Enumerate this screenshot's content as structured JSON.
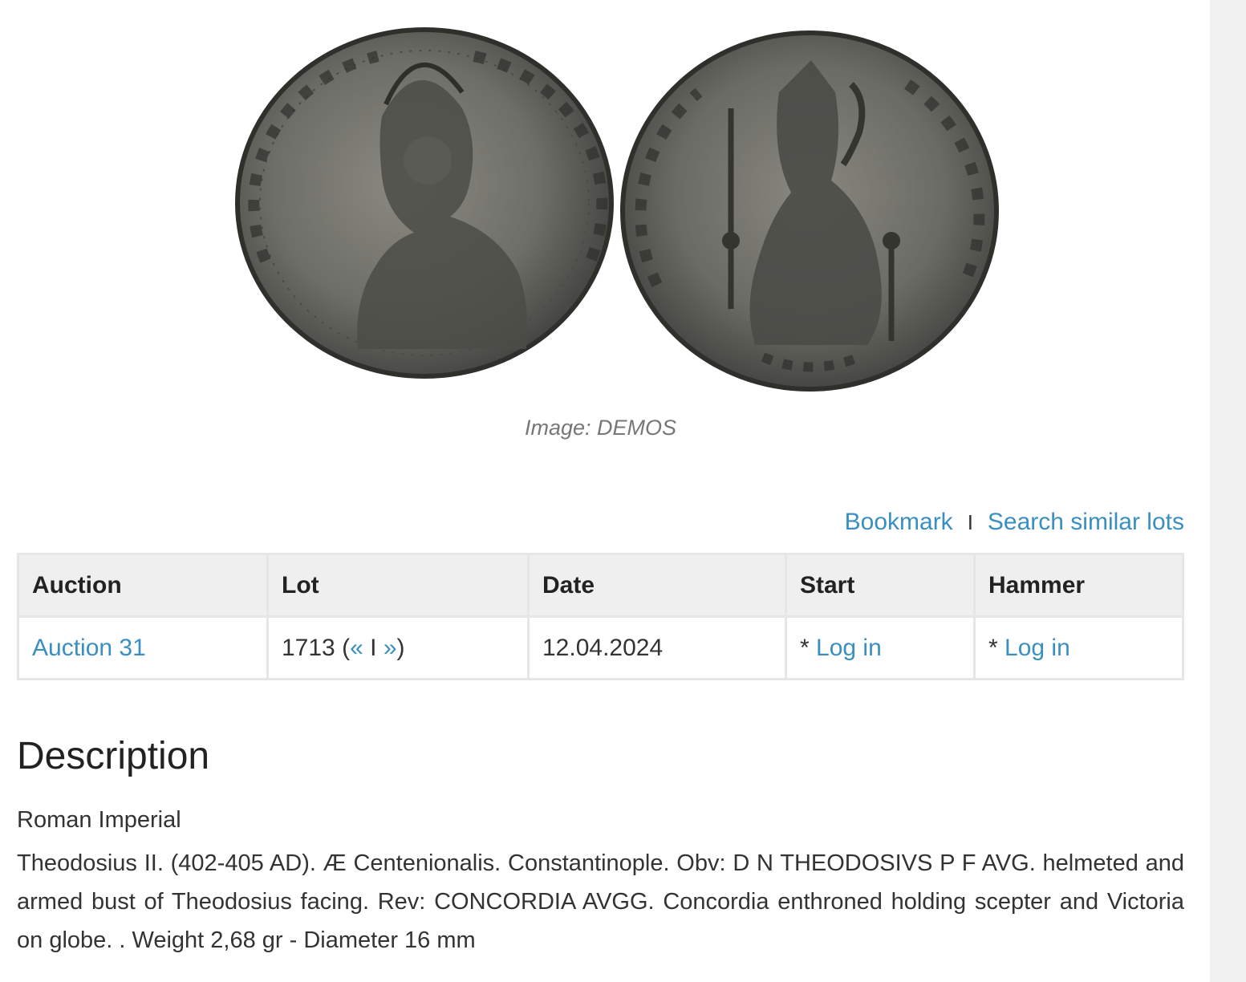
{
  "image": {
    "caption": "Image: DEMOS",
    "obverse_alt": "Obverse of coin",
    "reverse_alt": "Reverse of coin"
  },
  "actions": {
    "bookmark": "Bookmark",
    "separator": "I",
    "search_similar": "Search similar lots"
  },
  "table": {
    "headers": [
      "Auction",
      "Lot",
      "Date",
      "Start",
      "Hammer"
    ],
    "row": {
      "auction": "Auction 31",
      "lot_number": "1713",
      "lot_open": "(",
      "prev": "«",
      "lot_sep": "I",
      "next": "»",
      "lot_close": ")",
      "date": "12.04.2024",
      "start_prefix": "* ",
      "start_link": "Log in",
      "hammer_prefix": "* ",
      "hammer_link": "Log in"
    }
  },
  "description": {
    "title": "Description",
    "category": "Roman Imperial",
    "body": "Theodosius II. (402-405 AD). Æ Centenionalis. Constantinople. Obv: D N THEODOSIVS P F AVG. helmeted and armed bust of Theodosius facing. Rev: CONCORDIA AVGG. Concordia enthroned holding scepter and Victoria on globe. . Weight 2,68 gr - Diameter 16 mm"
  },
  "colors": {
    "link": "#3a8fc2",
    "header_bg": "#efefef",
    "border": "#e6e6e6",
    "coin_metal": "#6e6e68"
  }
}
